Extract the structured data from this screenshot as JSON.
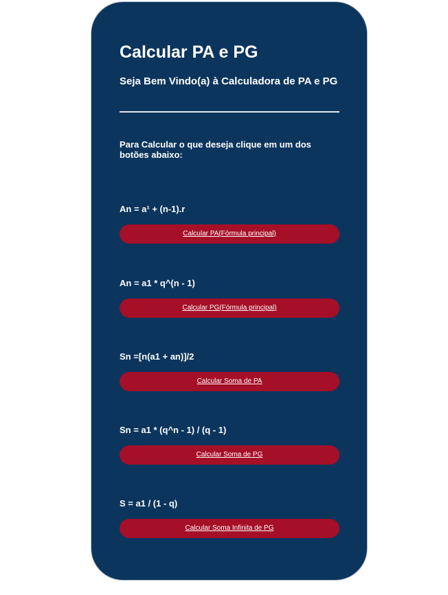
{
  "page": {
    "title": "Calcular PA e PG",
    "subtitle": "Seja Bem Vindo(a) à Calculadora de PA e PG",
    "instructions": "Para Calcular o que deseja clique em um dos botões abaixo:"
  },
  "calculators": [
    {
      "formula": "An = a¹ + (n-1).r",
      "button": "Calcular PA(Fórmula principal)"
    },
    {
      "formula": "An = a1 * q^(n - 1)",
      "button": "Calcular PG(Fórmula principal)"
    },
    {
      "formula": "Sn =[n(a1 + an)]/2",
      "button": "Calcular Soma de PA"
    },
    {
      "formula": "Sn = a1 * (q^n - 1) / (q - 1)",
      "button": "Calcular Soma de PG"
    },
    {
      "formula": "S = a1 / (1 - q)",
      "button": "Calcular Soma Infinita de PG"
    }
  ],
  "colors": {
    "card_background": "#0c355d",
    "button_background": "#a50f27",
    "text": "#ffffff"
  }
}
